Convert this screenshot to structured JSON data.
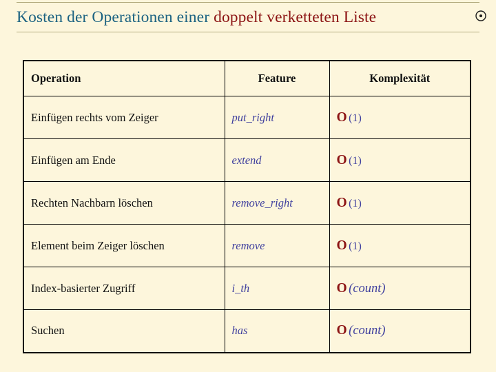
{
  "header": {
    "title_part_1": "Kosten der Operationen einer ",
    "title_part_2": "doppelt verketteten Liste",
    "badge_icon": "circle-dot-icon",
    "rule_color": "#b3ab7e",
    "title_color_primary": "#1d6382",
    "title_color_accent": "#8d1515"
  },
  "table": {
    "columns": [
      {
        "label": "Operation",
        "align": "left"
      },
      {
        "label": "Feature",
        "align": "center"
      },
      {
        "label": "Komplexität",
        "align": "center"
      }
    ],
    "complexity_column_bg": "#dbe6f2",
    "rows": [
      {
        "operation": "Einfügen rechts vom Zeiger",
        "feature": "put_right",
        "complexity_o": "O",
        "complexity_arg": "(1)",
        "complexity_arg_italic": false
      },
      {
        "operation": "Einfügen am Ende",
        "feature": "extend",
        "complexity_o": "O",
        "complexity_arg": "(1)",
        "complexity_arg_italic": false
      },
      {
        "operation": "Rechten Nachbarn löschen",
        "feature": "remove_right",
        "complexity_o": "O",
        "complexity_arg": "(1)",
        "complexity_arg_italic": false
      },
      {
        "operation": "Element beim Zeiger löschen",
        "feature": "remove",
        "complexity_o": "O",
        "complexity_arg": "(1)",
        "complexity_arg_italic": false
      },
      {
        "operation": "Index-basierter Zugriff",
        "feature": "i_th",
        "complexity_o": "O",
        "complexity_arg": "(count)",
        "complexity_arg_italic": true
      },
      {
        "operation": "Suchen",
        "feature": "has",
        "complexity_o": "O",
        "complexity_arg": "(count)",
        "complexity_arg_italic": true
      }
    ]
  }
}
